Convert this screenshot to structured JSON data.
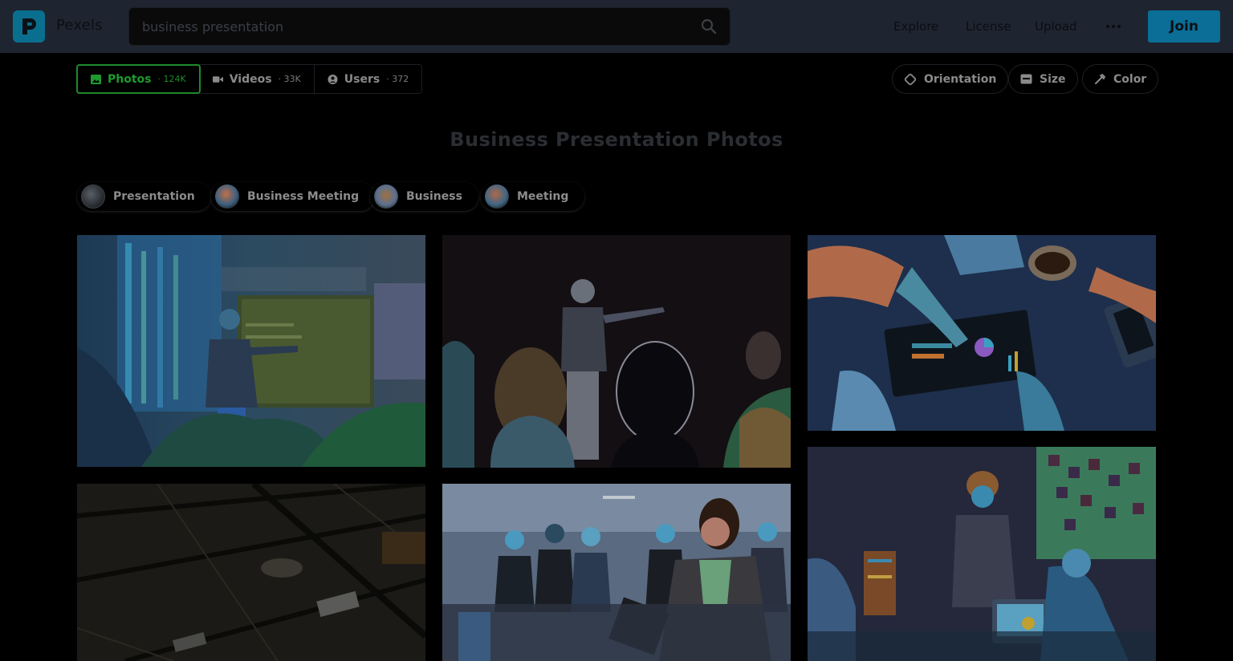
{
  "header": {
    "brand": "Pexels",
    "search_value": "business presentation",
    "nav": [
      "Explore",
      "License",
      "Upload"
    ],
    "join_label": "Join"
  },
  "tabs": [
    {
      "label": "Photos",
      "count": "· 124K",
      "icon": "image-icon",
      "active": true
    },
    {
      "label": "Videos",
      "count": "· 33K",
      "icon": "video-icon",
      "active": false
    },
    {
      "label": "Users",
      "count": "· 372",
      "icon": "user-circle-icon",
      "active": false
    }
  ],
  "filters": [
    {
      "label": "Orientation",
      "icon": "orientation-icon"
    },
    {
      "label": "Size",
      "icon": "size-icon"
    },
    {
      "label": "Color",
      "icon": "color-picker-icon"
    }
  ],
  "page_title": "Business Presentation Photos",
  "related": [
    "Presentation",
    "Business Meeting",
    "Business",
    "Meeting"
  ],
  "colors": {
    "header_bg": "#1e2530",
    "accent_green": "#1f9a2f",
    "join_bg": "#0a6e97",
    "page_bg": "#000000"
  }
}
